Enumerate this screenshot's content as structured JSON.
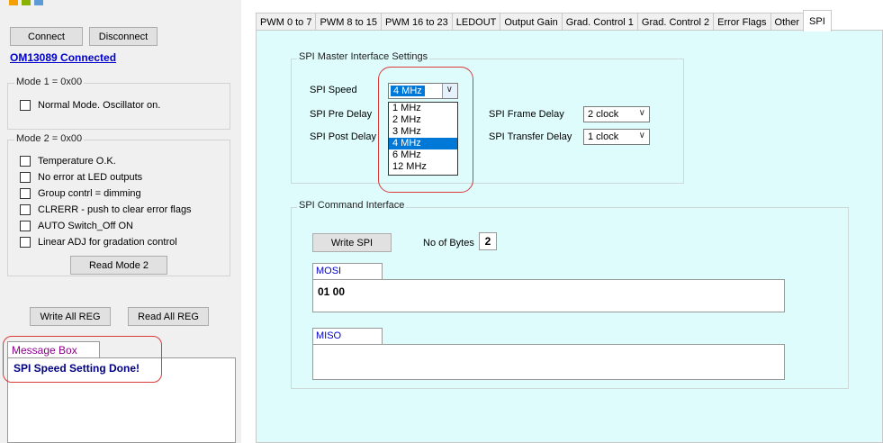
{
  "connection": {
    "connect_label": "Connect",
    "disconnect_label": "Disconnect",
    "status": "OM13089 Connected"
  },
  "mode1": {
    "title": "Mode 1 = 0x00",
    "items": [
      {
        "label": "Normal Mode. Oscillator on."
      }
    ]
  },
  "mode2": {
    "title": "Mode 2 = 0x00",
    "items": [
      {
        "label": "Temperature O.K."
      },
      {
        "label": "No error at LED outputs"
      },
      {
        "label": "Group contrl = dimming"
      },
      {
        "label": "CLRERR - push to clear error flags"
      },
      {
        "label": "AUTO Switch_Off ON"
      },
      {
        "label": "Linear ADJ for gradation control"
      }
    ],
    "read_label": "Read Mode 2"
  },
  "registers": {
    "write_all_label": "Write All REG",
    "read_all_label": "Read All REG"
  },
  "message_box": {
    "title": "Message Box",
    "text": "SPI Speed Setting Done!"
  },
  "tabs": [
    {
      "label": "PWM 0 to 7"
    },
    {
      "label": "PWM 8 to 15"
    },
    {
      "label": "PWM 16 to 23"
    },
    {
      "label": "LEDOUT"
    },
    {
      "label": "Output Gain"
    },
    {
      "label": "Grad. Control 1"
    },
    {
      "label": "Grad. Control 2"
    },
    {
      "label": "Error Flags"
    },
    {
      "label": "Other"
    },
    {
      "label": "SPI"
    }
  ],
  "spi_settings": {
    "title": "SPI Master Interface Settings",
    "speed_label": "SPI Speed",
    "speed_value": "4 MHz",
    "speed_options": [
      "1 MHz",
      "2 MHz",
      "3 MHz",
      "4 MHz",
      "6 MHz",
      "12 MHz"
    ],
    "pre_delay_label": "SPI Pre Delay",
    "post_delay_label": "SPI Post Delay",
    "frame_delay_label": "SPI Frame Delay",
    "frame_delay_value": "2 clock",
    "transfer_delay_label": "SPI Transfer Delay",
    "transfer_delay_value": "1 clock"
  },
  "spi_command": {
    "title": "SPI Command Interface",
    "write_label": "Write SPI",
    "bytes_label": "No of Bytes",
    "bytes_value": "2",
    "mosi_label": "MOSI",
    "mosi_value": "01 00",
    "miso_label": "MISO",
    "miso_value": ""
  },
  "colors": {
    "panel_bg": "#dffcfd",
    "link": "#0000cc",
    "message_title": "#8b008b",
    "message_text": "#000080",
    "highlight": "#0078d7",
    "annotation": "#d93a3a"
  }
}
